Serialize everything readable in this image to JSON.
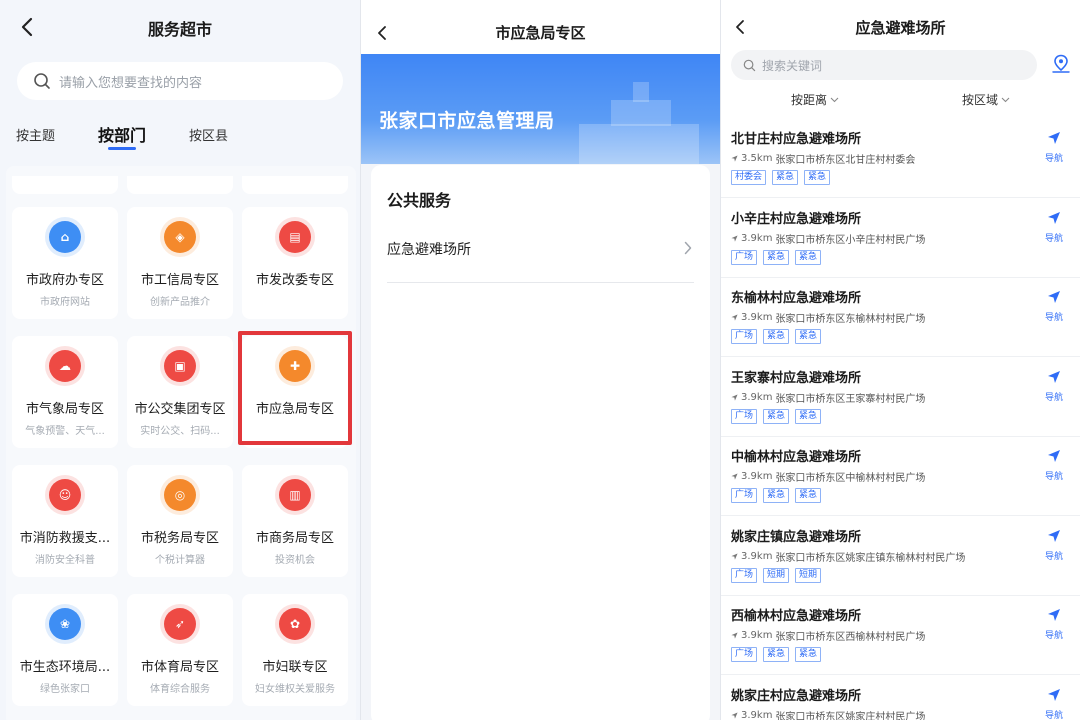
{
  "panel1": {
    "title": "服务超市",
    "search_placeholder": "请输入您想要查找的内容",
    "tabs": [
      "按主题",
      "按部门",
      "按区县"
    ],
    "active_tab": "按部门",
    "cards": [
      {
        "name": "市政府办专区",
        "sub": "市政府网站",
        "icon": "government-building-icon",
        "color": "#3f8ef5"
      },
      {
        "name": "市工信局专区",
        "sub": "创新产品推介",
        "icon": "shield-badge-icon",
        "color": "#f5892d"
      },
      {
        "name": "市发改委专区",
        "sub": "",
        "icon": "document-building-icon",
        "color": "#ef4b45"
      },
      {
        "name": "市气象局专区",
        "sub": "气象预警、天气...",
        "icon": "weather-cloud-icon",
        "color": "#ef4b45"
      },
      {
        "name": "市公交集团专区",
        "sub": "实时公交、扫码...",
        "icon": "bus-icon",
        "color": "#ef4b45"
      },
      {
        "name": "市应急局专区",
        "sub": "",
        "icon": "emergency-box-icon",
        "color": "#f5892d"
      },
      {
        "name": "市消防救援支...",
        "sub": "消防安全科普",
        "icon": "firefighter-icon",
        "color": "#ef4b45"
      },
      {
        "name": "市税务局专区",
        "sub": "个税计算器",
        "icon": "tax-coin-icon",
        "color": "#f5892d"
      },
      {
        "name": "市商务局专区",
        "sub": "投资机会",
        "icon": "commerce-building-icon",
        "color": "#ef4b45"
      },
      {
        "name": "市生态环境局...",
        "sub": "绿色张家口",
        "icon": "environment-leaf-icon",
        "color": "#3f8ef5"
      },
      {
        "name": "市体育局专区",
        "sub": "体育综合服务",
        "icon": "running-person-icon",
        "color": "#ef4b45"
      },
      {
        "name": "市妇联专区",
        "sub": "妇女维权关爱服务",
        "icon": "women-federation-icon",
        "color": "#ef4b45"
      }
    ]
  },
  "panel2": {
    "title": "市应急局专区",
    "banner": "张家口市应急管理局",
    "section": "公共服务",
    "item": "应急避难场所"
  },
  "panel3": {
    "title": "应急避难场所",
    "search_placeholder": "搜索关键词",
    "filters": [
      "按距离",
      "按区域"
    ],
    "nav_label": "导航",
    "items": [
      {
        "name": "北甘庄村应急避难场所",
        "distance": "3.5km",
        "address": "张家口市桥东区北甘庄村村委会",
        "tags": [
          "村委会",
          "紧急",
          "紧急"
        ]
      },
      {
        "name": "小辛庄村应急避难场所",
        "distance": "3.9km",
        "address": "张家口市桥东区小辛庄村村民广场",
        "tags": [
          "广场",
          "紧急",
          "紧急"
        ]
      },
      {
        "name": "东榆林村应急避难场所",
        "distance": "3.9km",
        "address": "张家口市桥东区东榆林村村民广场",
        "tags": [
          "广场",
          "紧急",
          "紧急"
        ]
      },
      {
        "name": "王家寨村应急避难场所",
        "distance": "3.9km",
        "address": "张家口市桥东区王家寨村村民广场",
        "tags": [
          "广场",
          "紧急",
          "紧急"
        ]
      },
      {
        "name": "中榆林村应急避难场所",
        "distance": "3.9km",
        "address": "张家口市桥东区中榆林村村民广场",
        "tags": [
          "广场",
          "紧急",
          "紧急"
        ]
      },
      {
        "name": "姚家庄镇应急避难场所",
        "distance": "3.9km",
        "address": "张家口市桥东区姚家庄镇东榆林村村民广场",
        "tags": [
          "广场",
          "短期",
          "短期"
        ]
      },
      {
        "name": "西榆林村应急避难场所",
        "distance": "3.9km",
        "address": "张家口市桥东区西榆林村村民广场",
        "tags": [
          "广场",
          "紧急",
          "紧急"
        ]
      },
      {
        "name": "姚家庄村应急避难场所",
        "distance": "3.9km",
        "address": "张家口市桥东区姚家庄村村民广场",
        "tags": []
      }
    ]
  }
}
